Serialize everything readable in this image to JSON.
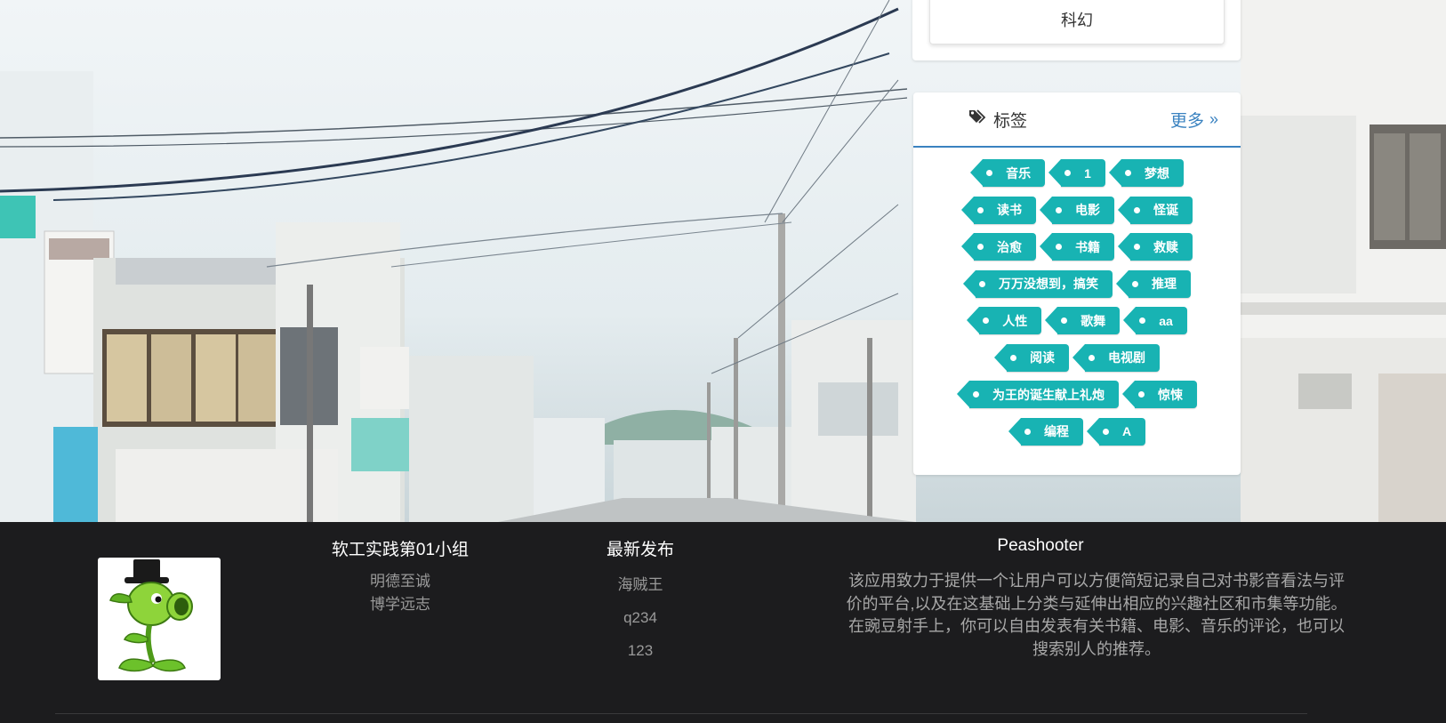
{
  "category_panel": {
    "label": "科幻"
  },
  "tags_panel": {
    "title": "标签",
    "more_label": "更多",
    "rows": [
      [
        "音乐",
        "1",
        "梦想"
      ],
      [
        "读书",
        "电影",
        "怪诞"
      ],
      [
        "治愈",
        "书籍",
        "救赎"
      ],
      [
        "万万没想到，搞笑",
        "推理"
      ],
      [
        "人性",
        "歌舞",
        "aa"
      ],
      [
        "阅读",
        "电视剧"
      ],
      [
        "为王的诞生献上礼炮",
        "惊悚"
      ],
      [
        "编程",
        "A"
      ]
    ]
  },
  "footer": {
    "group": {
      "title": "软工实践第01小组",
      "lines": [
        "明德至诚",
        "博学远志"
      ]
    },
    "latest": {
      "title": "最新发布",
      "items": [
        "海贼王",
        "q234",
        "123"
      ]
    },
    "about": {
      "title": "Peashooter",
      "lines": [
        "该应用致力于提供一个让用户可以方便简短记录自己对书影音看法与评",
        "价的平台,以及在这基础上分类与延伸出相应的兴趣社区和市集等功能。",
        "在豌豆射手上，你可以自由发表有关书籍、电影、音乐的评论，也可以",
        "搜索别人的推荐。"
      ]
    }
  },
  "colors": {
    "tag": "#18b3b3",
    "link": "#3a82c0",
    "footer_bg": "#1c1c1e"
  },
  "icons": {
    "tags": "tags-icon",
    "more": "double-chevron-right-icon",
    "avatar": "peashooter-avatar"
  }
}
